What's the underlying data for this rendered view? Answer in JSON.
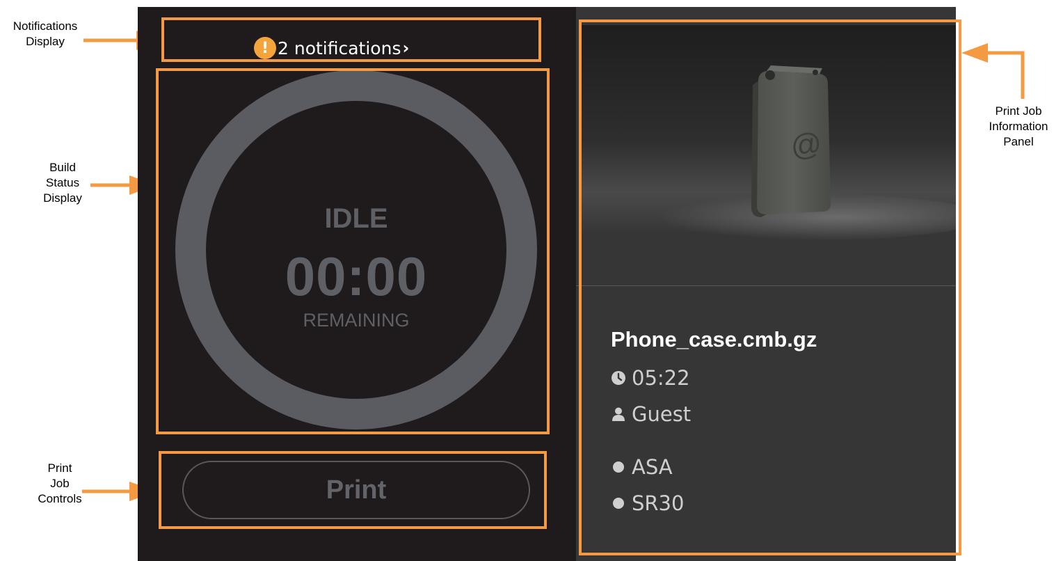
{
  "callouts": {
    "notifications": "Notifications\nDisplay",
    "build_status": "Build\nStatus\nDisplay",
    "print_job_controls": "Print\nJob\nControls",
    "print_job_info": "Print Job\nInformation\nPanel"
  },
  "notifications": {
    "badge": "!",
    "text": "2 notifications",
    "chevron": "›"
  },
  "build_status": {
    "state": "IDLE",
    "time": "00:00",
    "caption": "REMAINING"
  },
  "controls": {
    "print_label": "Print"
  },
  "job": {
    "filename": "Phone_case.cmb.gz",
    "duration": "05:22",
    "user": "Guest",
    "materials": [
      "ASA",
      "SR30"
    ]
  },
  "icons": {
    "badge": "exclamation-circle-icon",
    "duration": "clock-icon",
    "user": "user-icon",
    "material": "dot-icon"
  },
  "colors": {
    "accent_frame": "#f49a43",
    "badge": "#f4a43a",
    "left_panel": "#1f1b1c",
    "right_panel": "#363636",
    "ring": "#5b5c61"
  }
}
